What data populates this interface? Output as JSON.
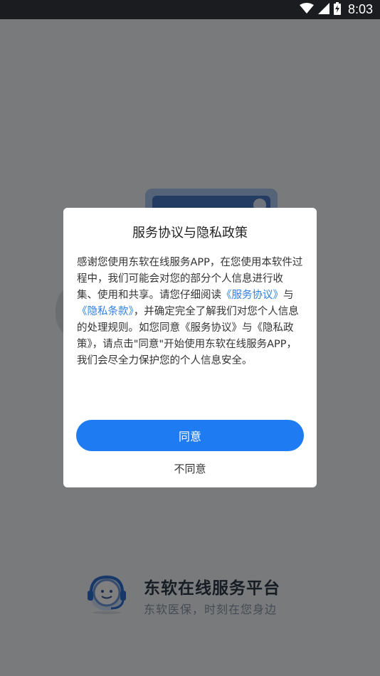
{
  "status_bar": {
    "time": "8:03",
    "icons": [
      "wifi-icon",
      "cellular-signal-icon",
      "battery-charging-icon"
    ]
  },
  "background": {
    "brand_title": "东软在线服务平台",
    "brand_slogan": "东软医保，时刻在您身边"
  },
  "dialog": {
    "title": "服务协议与隐私政策",
    "body": {
      "part1": "感谢您使用东软在线服务APP，在您使用本软件过程中，我们可能会对您的部分个人信息进行收集、使用和共享。请您仔细阅读",
      "link1": "《服务协议》",
      "part2": "与",
      "link2": "《隐私条款》",
      "part3": "，并确定完全了解我们对您个人信息的处理规则。如您同意《服务协议》与《隐私政策》，请点击\"同意\"开始使用东软在线服务APP，我们会尽全力保护您的个人信息安全。"
    },
    "agree_label": "同意",
    "disagree_label": "不同意"
  },
  "colors": {
    "accent": "#1f7bf2",
    "link": "#2f7fe0",
    "status_bar": "#1a1c1f"
  }
}
